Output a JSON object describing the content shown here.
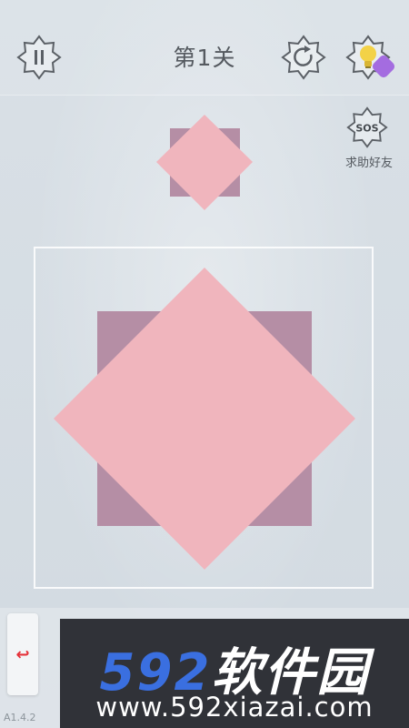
{
  "topbar": {
    "pause_icon": "pause-icon",
    "level_title": "第1关",
    "restart_icon": "restart-icon",
    "hint_icon": "lightbulb-icon"
  },
  "sos": {
    "icon_text": "SOS",
    "label": "求助好友"
  },
  "colors": {
    "pink": "#f0b5bd",
    "mauve": "#b58ea5",
    "hint_badge": "#a46ce0",
    "undo_red": "#e5323a"
  },
  "undo": {
    "icon": "↩"
  },
  "version": "A1.4.2",
  "watermark": {
    "num": "592",
    "cn": "软件园",
    "url": "www.592xiazai.com"
  }
}
